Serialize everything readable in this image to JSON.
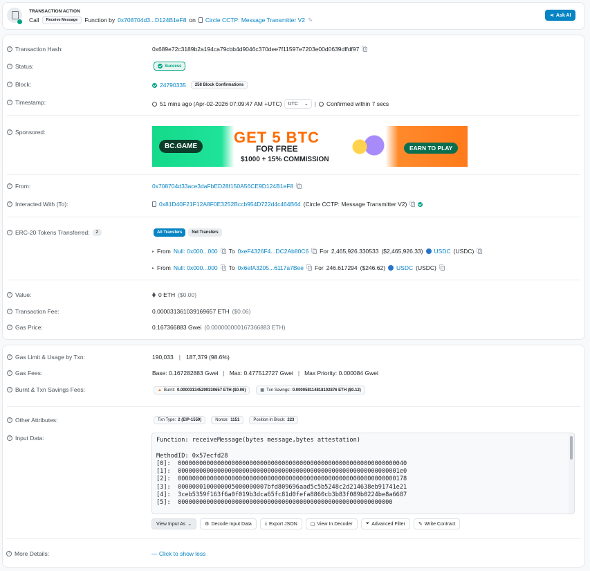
{
  "header": {
    "section_title": "TRANSACTION ACTION",
    "call": "Call",
    "method_badge": "Receive Message",
    "function_by": "Function by",
    "from_short": "0x708704d3...D124B1eF8",
    "on": "on",
    "contract_name": "Circle CCTP: Message Transmitter V2",
    "ask_ai": "Ask AI"
  },
  "rows": {
    "hash": {
      "label": "Transaction Hash:",
      "value": "0x689e72c3189b2a194ca79cbb4d9046c370dee7f11597e7203e00d0639dffdf97"
    },
    "status": {
      "label": "Status:",
      "value": "Success"
    },
    "block": {
      "label": "Block:",
      "value": "24790335",
      "confirmations": "258 Block Confirmations"
    },
    "timestamp": {
      "label": "Timestamp:",
      "value": "51 mins ago (Apr-02-2026 07:09:47 AM +UTC)",
      "tz": "UTC",
      "confirmed": "Confirmed within 7 secs"
    },
    "sponsored": {
      "label": "Sponsored:"
    },
    "from": {
      "label": "From:",
      "value": "0x708704d33ace3daFbED28f150A56CE9D124B1eF8"
    },
    "to": {
      "label": "Interacted With (To):",
      "value": "0x81D40F21F12A8F0E3252Bccb954D722d4c464B64",
      "name": "(Circle CCTP: Message Transmitter V2)"
    },
    "erc20": {
      "label": "ERC-20 Tokens Transferred:",
      "count": "2",
      "tab_all": "All Transfers",
      "tab_net": "Net Transfers"
    },
    "value": {
      "label": "Value:",
      "value": "0 ETH",
      "usd": "($0.00)"
    },
    "fee": {
      "label": "Transaction Fee:",
      "value": "0.000031361039169657 ETH",
      "usd": "($0.06)"
    },
    "gas_price": {
      "label": "Gas Price:",
      "value": "0.167366883 Gwei",
      "eth": "(0.000000000167366883 ETH)"
    },
    "gas_limit": {
      "label": "Gas Limit & Usage by Txn:",
      "limit": "190,033",
      "usage": "187,379 (98.6%)"
    },
    "gas_fees": {
      "label": "Gas Fees:",
      "base": "Base: 0.167282883 Gwei",
      "max": "Max: 0.477512727 Gwei",
      "priority": "Max Priority: 0.000084 Gwei"
    },
    "burnt": {
      "label": "Burnt & Txn Savings Fees:",
      "burnt_label": "Burnt:",
      "burnt": "0.000031345299330657 ETH ($0.06)",
      "savings_label": "Txn Savings:",
      "savings": "0.000058114818102876 ETH ($0.12)"
    },
    "other": {
      "label": "Other Attributes:",
      "txn_type_label": "Txn Type:",
      "txn_type": "2 (EIP-1559)",
      "nonce_label": "Nonce:",
      "nonce": "1151",
      "position_label": "Position In Block:",
      "position": "223"
    },
    "input": {
      "label": "Input Data:"
    },
    "more": {
      "label": "More Details:",
      "action": "— Click to show less"
    }
  },
  "transfers": [
    {
      "from_label": "From",
      "from": "Null: 0x000...000",
      "to_label": "To",
      "to": "0xeF4326F4...DC2Ab80C6",
      "for_label": "For",
      "amount": "2,465,926.330533",
      "usd": "($2,465,926.33)",
      "token": "USDC",
      "symbol": "(USDC)"
    },
    {
      "from_label": "From",
      "from": "Null: 0x000...000",
      "to_label": "To",
      "to": "0x6efA3205...6117a7Bee",
      "for_label": "For",
      "amount": "246.617294",
      "usd": "($246.62)",
      "token": "USDC",
      "symbol": "(USDC)"
    }
  ],
  "banner": {
    "brand": "BC.GAME",
    "headline": "GET 5 BTC",
    "sub": "FOR FREE",
    "bonus": "$1000 + 15% COMMISSION",
    "cta": "EARN TO PLAY"
  },
  "input_data": {
    "code": "Function: receiveMessage(bytes message,bytes attestation)\n\nMethodID: 0x57ecfd28\n[0]:  0000000000000000000000000000000000000000000000000000000000000040\n[1]:  00000000000000000000000000000000000000000000000000000000000001e0\n[2]:  0000000000000000000000000000000000000000000000000000000000000178\n[3]:  0000000100000005000000007bfd809696aad5c5b5248c2d214638eb91741e21\n[4]:  3ceb5359f163f6a0f019b3dca65fc81d0fefa8860cb3b83f089b0224be8a6687\n[5]:  000000000000000000000000000000000000000000000000000000000000",
    "buttons": [
      "View Input As",
      "Decode Input Data",
      "Export JSON",
      "View In Decoder",
      "Advanced Filter",
      "Write Contract"
    ]
  },
  "colors": {
    "link": "#0784c3",
    "success": "#00a186",
    "ask_ai": "#0784c3",
    "banner_green": "#14d98a",
    "banner_orange": "#ff7a1a"
  }
}
